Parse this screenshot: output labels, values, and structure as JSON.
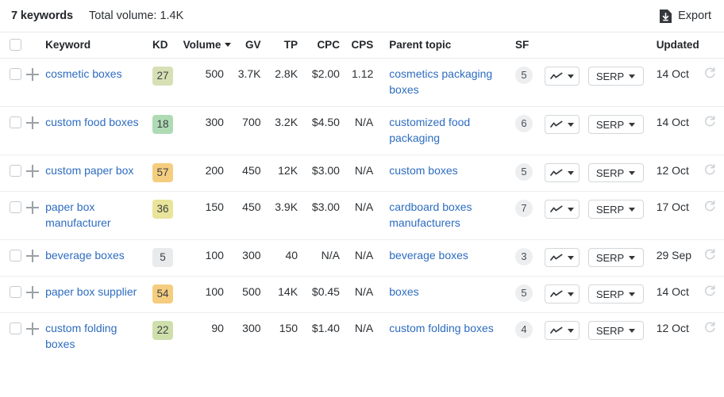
{
  "topbar": {
    "keyword_count": "7 keywords",
    "total_volume": "Total volume: 1.4K",
    "export_label": "Export",
    "export_icon": "export-download-icon"
  },
  "table": {
    "columns": {
      "keyword": "Keyword",
      "kd": "KD",
      "volume": "Volume",
      "gv": "GV",
      "tp": "TP",
      "cpc": "CPC",
      "cps": "CPS",
      "parent_topic": "Parent topic",
      "sf": "SF",
      "updated": "Updated"
    },
    "sort": {
      "column": "Volume",
      "direction": "desc"
    },
    "controls": {
      "trend_label": "",
      "serp_label": "SERP",
      "trend_icon": "sparkline-icon",
      "caret_icon": "chevron-down-icon",
      "refresh_icon": "refresh-icon",
      "plus_icon": "plus-icon",
      "checkbox_icon": "checkbox-unchecked"
    },
    "rows": [
      {
        "keyword": "cosmetic boxes",
        "kd": "27",
        "kd_color": "#d6e0b4",
        "volume": "500",
        "gv": "3.7K",
        "tp": "2.8K",
        "cpc": "$2.00",
        "cps": "1.12",
        "parent_topic": "cosmetics packaging boxes",
        "sf": "5",
        "serp": "SERP",
        "updated": "14 Oct"
      },
      {
        "keyword": "custom food boxes",
        "kd": "18",
        "kd_color": "#aedbb4",
        "volume": "300",
        "gv": "700",
        "tp": "3.2K",
        "cpc": "$4.50",
        "cps": "N/A",
        "parent_topic": "customized food packaging",
        "sf": "6",
        "serp": "SERP",
        "updated": "14 Oct"
      },
      {
        "keyword": "custom paper box",
        "kd": "57",
        "kd_color": "#f5cd7f",
        "volume": "200",
        "gv": "450",
        "tp": "12K",
        "cpc": "$3.00",
        "cps": "N/A",
        "parent_topic": "custom boxes",
        "sf": "5",
        "serp": "SERP",
        "updated": "12 Oct"
      },
      {
        "keyword": "paper box manufacturer",
        "kd": "36",
        "kd_color": "#e8e49a",
        "volume": "150",
        "gv": "450",
        "tp": "3.9K",
        "cpc": "$3.00",
        "cps": "N/A",
        "parent_topic": "cardboard boxes manufacturers",
        "sf": "7",
        "serp": "SERP",
        "updated": "17 Oct"
      },
      {
        "keyword": "beverage boxes",
        "kd": "5",
        "kd_color": "#e9eaec",
        "volume": "100",
        "gv": "300",
        "tp": "40",
        "cpc": "N/A",
        "cps": "N/A",
        "parent_topic": "beverage boxes",
        "sf": "3",
        "serp": "SERP",
        "updated": "29 Sep"
      },
      {
        "keyword": "paper box supplier",
        "kd": "54",
        "kd_color": "#f5cd7f",
        "volume": "100",
        "gv": "500",
        "tp": "14K",
        "cpc": "$0.45",
        "cps": "N/A",
        "parent_topic": "boxes",
        "sf": "5",
        "serp": "SERP",
        "updated": "14 Oct"
      },
      {
        "keyword": "custom folding boxes",
        "kd": "22",
        "kd_color": "#cfdfac",
        "volume": "90",
        "gv": "300",
        "tp": "150",
        "cpc": "$1.40",
        "cps": "N/A",
        "parent_topic": "custom folding boxes",
        "sf": "4",
        "serp": "SERP",
        "updated": "12 Oct"
      }
    ]
  },
  "colors": {
    "link": "#2d6cc0",
    "text": "#2b2f33",
    "muted": "#b4b8bc",
    "border": "#e8eaed"
  }
}
